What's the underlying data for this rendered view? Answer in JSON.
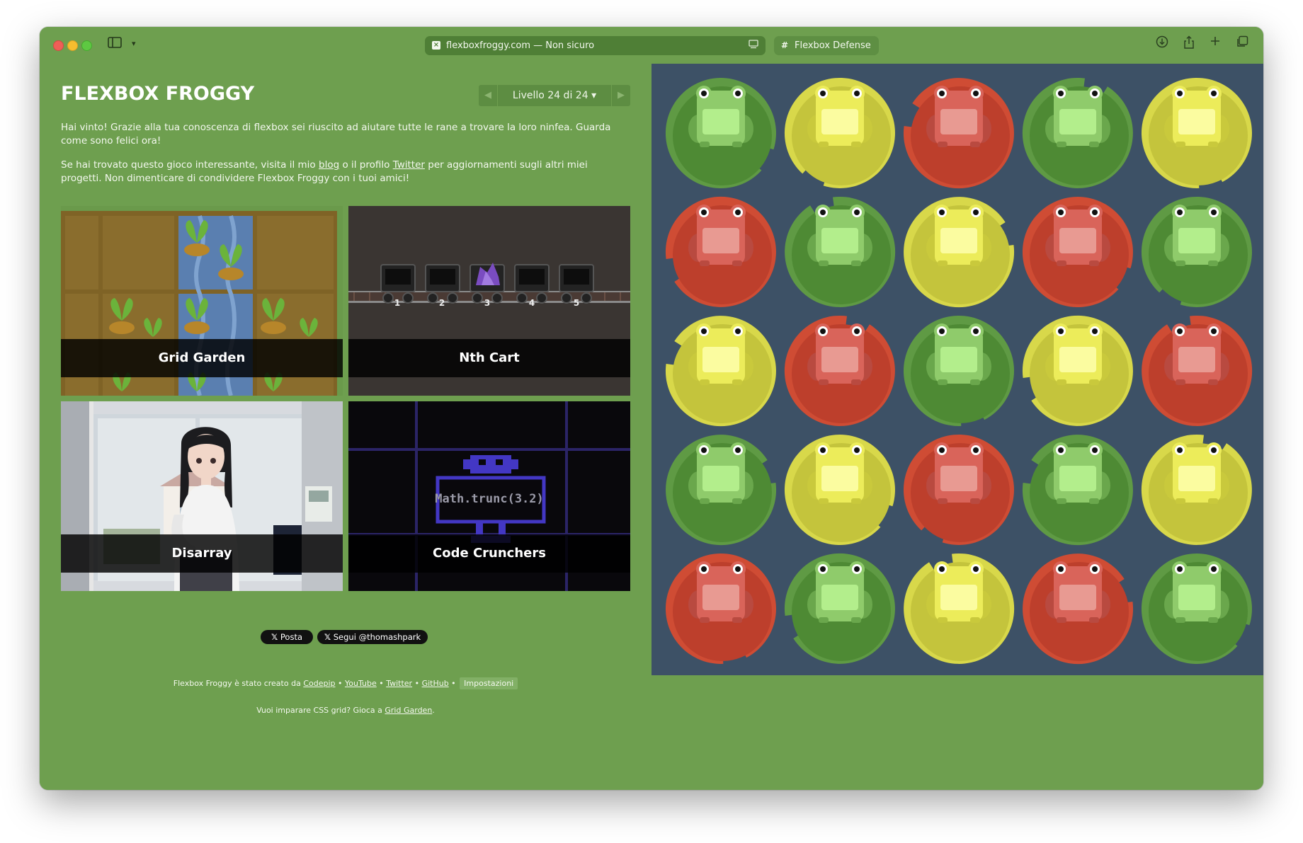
{
  "browser": {
    "address_url": "flexboxfroggy.com — Non sicuro",
    "tab2_title": "Flexbox Defense"
  },
  "game": {
    "logo": "FLEXBOX FROGGY",
    "level_label": "Livello 24 di 24",
    "win_text": "Hai vinto! Grazie alla tua conoscenza di flexbox sei riuscito ad aiutare tutte le rane a trovare la loro ninfea. Guarda come sono felici ora!",
    "promo_prefix": "Se hai trovato questo gioco interessante, visita il mio",
    "promo_blog": "blog",
    "promo_mid": "o il profilo",
    "promo_twitter": "Twitter",
    "promo_suffix": "per aggiornamenti sugli altri miei progetti. Non dimenticare di condividere Flexbox Froggy con i tuoi amici!"
  },
  "cards": [
    {
      "label": "Grid Garden"
    },
    {
      "label": "Nth Cart"
    },
    {
      "label": "Disarray"
    },
    {
      "label": "Code Crunchers",
      "code": "Math.trunc(3.2)"
    }
  ],
  "carts": [
    "1",
    "2",
    "3",
    "4",
    "5"
  ],
  "social": {
    "post": "Posta",
    "follow": "Segui @thomashpark"
  },
  "footer": {
    "created_by": "Flexbox Froggy è stato creato da",
    "codepip": "Codepip",
    "youtube": "YouTube",
    "twitter": "Twitter",
    "github": "GitHub",
    "settings": "Impostazioni",
    "learn_prefix": "Vuoi imparare CSS grid? Gioca a",
    "grid_garden": "Grid Garden"
  },
  "colors": {
    "green": "#4e8a34",
    "yellow": "#c4c43c",
    "red": "#bd3f2c",
    "board_bg": "#3d5166"
  },
  "board": [
    [
      "green",
      "yellow",
      "red",
      "green",
      "yellow"
    ],
    [
      "red",
      "green",
      "yellow",
      "red",
      "green"
    ],
    [
      "yellow",
      "red",
      "green",
      "yellow",
      "red"
    ],
    [
      "green",
      "yellow",
      "red",
      "green",
      "yellow"
    ],
    [
      "red",
      "green",
      "yellow",
      "red",
      "green"
    ]
  ]
}
